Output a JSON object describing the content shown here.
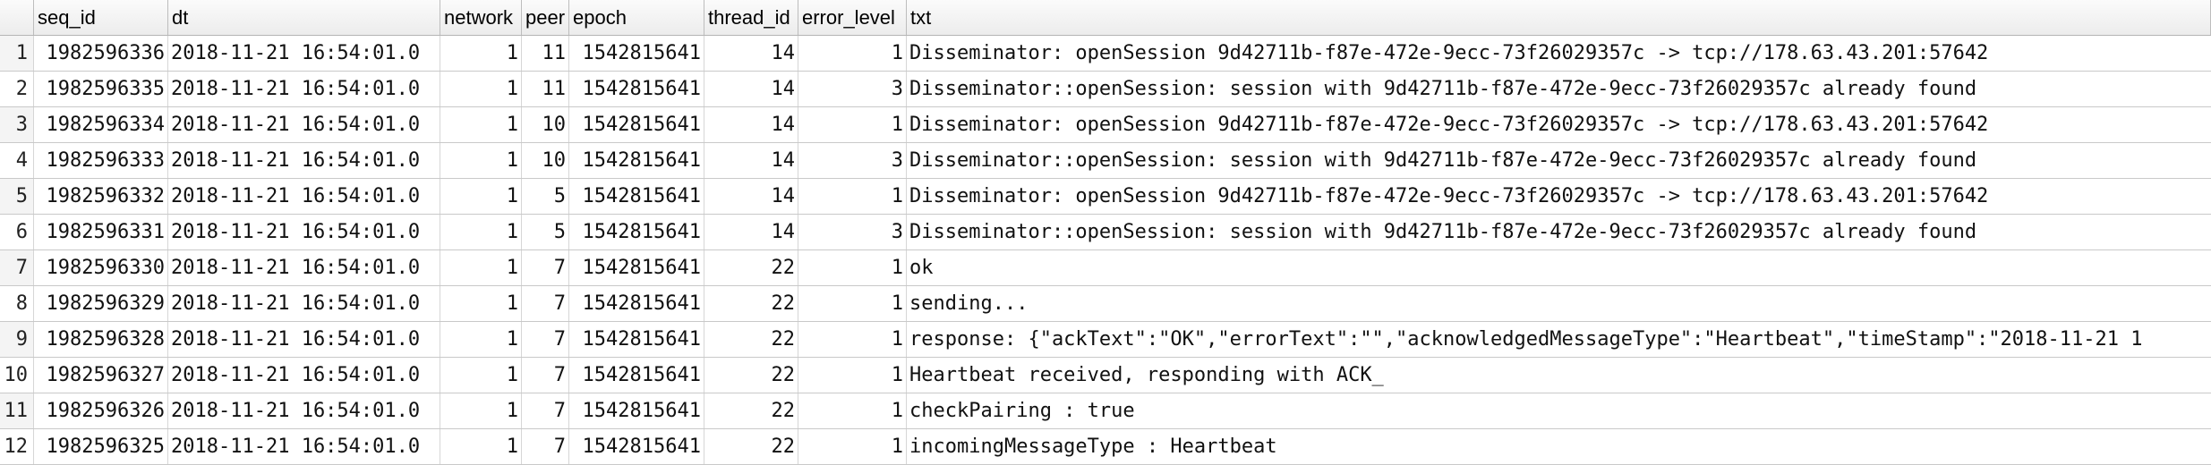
{
  "columns": [
    "seq_id",
    "dt",
    "network",
    "peer",
    "epoch",
    "thread_id",
    "error_level",
    "txt"
  ],
  "rows": [
    {
      "n": "1",
      "seq_id": "1982596336",
      "dt": "2018-11-21 16:54:01.0",
      "network": "1",
      "peer": "11",
      "epoch": "1542815641",
      "thread_id": "14",
      "error_level": "1",
      "txt": "Disseminator: openSession 9d42711b-f87e-472e-9ecc-73f26029357c -> tcp://178.63.43.201:57642"
    },
    {
      "n": "2",
      "seq_id": "1982596335",
      "dt": "2018-11-21 16:54:01.0",
      "network": "1",
      "peer": "11",
      "epoch": "1542815641",
      "thread_id": "14",
      "error_level": "3",
      "txt": "Disseminator::openSession: session with 9d42711b-f87e-472e-9ecc-73f26029357c already found"
    },
    {
      "n": "3",
      "seq_id": "1982596334",
      "dt": "2018-11-21 16:54:01.0",
      "network": "1",
      "peer": "10",
      "epoch": "1542815641",
      "thread_id": "14",
      "error_level": "1",
      "txt": "Disseminator: openSession 9d42711b-f87e-472e-9ecc-73f26029357c -> tcp://178.63.43.201:57642"
    },
    {
      "n": "4",
      "seq_id": "1982596333",
      "dt": "2018-11-21 16:54:01.0",
      "network": "1",
      "peer": "10",
      "epoch": "1542815641",
      "thread_id": "14",
      "error_level": "3",
      "txt": "Disseminator::openSession: session with 9d42711b-f87e-472e-9ecc-73f26029357c already found"
    },
    {
      "n": "5",
      "seq_id": "1982596332",
      "dt": "2018-11-21 16:54:01.0",
      "network": "1",
      "peer": "5",
      "epoch": "1542815641",
      "thread_id": "14",
      "error_level": "1",
      "txt": "Disseminator: openSession 9d42711b-f87e-472e-9ecc-73f26029357c -> tcp://178.63.43.201:57642"
    },
    {
      "n": "6",
      "seq_id": "1982596331",
      "dt": "2018-11-21 16:54:01.0",
      "network": "1",
      "peer": "5",
      "epoch": "1542815641",
      "thread_id": "14",
      "error_level": "3",
      "txt": "Disseminator::openSession: session with 9d42711b-f87e-472e-9ecc-73f26029357c already found"
    },
    {
      "n": "7",
      "seq_id": "1982596330",
      "dt": "2018-11-21 16:54:01.0",
      "network": "1",
      "peer": "7",
      "epoch": "1542815641",
      "thread_id": "22",
      "error_level": "1",
      "txt": "ok"
    },
    {
      "n": "8",
      "seq_id": "1982596329",
      "dt": "2018-11-21 16:54:01.0",
      "network": "1",
      "peer": "7",
      "epoch": "1542815641",
      "thread_id": "22",
      "error_level": "1",
      "txt": "sending..."
    },
    {
      "n": "9",
      "seq_id": "1982596328",
      "dt": "2018-11-21 16:54:01.0",
      "network": "1",
      "peer": "7",
      "epoch": "1542815641",
      "thread_id": "22",
      "error_level": "1",
      "txt": "response: {\"ackText\":\"OK\",\"errorText\":\"\",\"acknowledgedMessageType\":\"Heartbeat\",\"timeStamp\":\"2018-11-21 1"
    },
    {
      "n": "10",
      "seq_id": "1982596327",
      "dt": "2018-11-21 16:54:01.0",
      "network": "1",
      "peer": "7",
      "epoch": "1542815641",
      "thread_id": "22",
      "error_level": "1",
      "txt": "Heartbeat received, responding with ACK_"
    },
    {
      "n": "11",
      "seq_id": "1982596326",
      "dt": "2018-11-21 16:54:01.0",
      "network": "1",
      "peer": "7",
      "epoch": "1542815641",
      "thread_id": "22",
      "error_level": "1",
      "txt": "checkPairing : true"
    },
    {
      "n": "12",
      "seq_id": "1982596325",
      "dt": "2018-11-21 16:54:01.0",
      "network": "1",
      "peer": "7",
      "epoch": "1542815641",
      "thread_id": "22",
      "error_level": "1",
      "txt": "incomingMessageType : Heartbeat"
    }
  ]
}
